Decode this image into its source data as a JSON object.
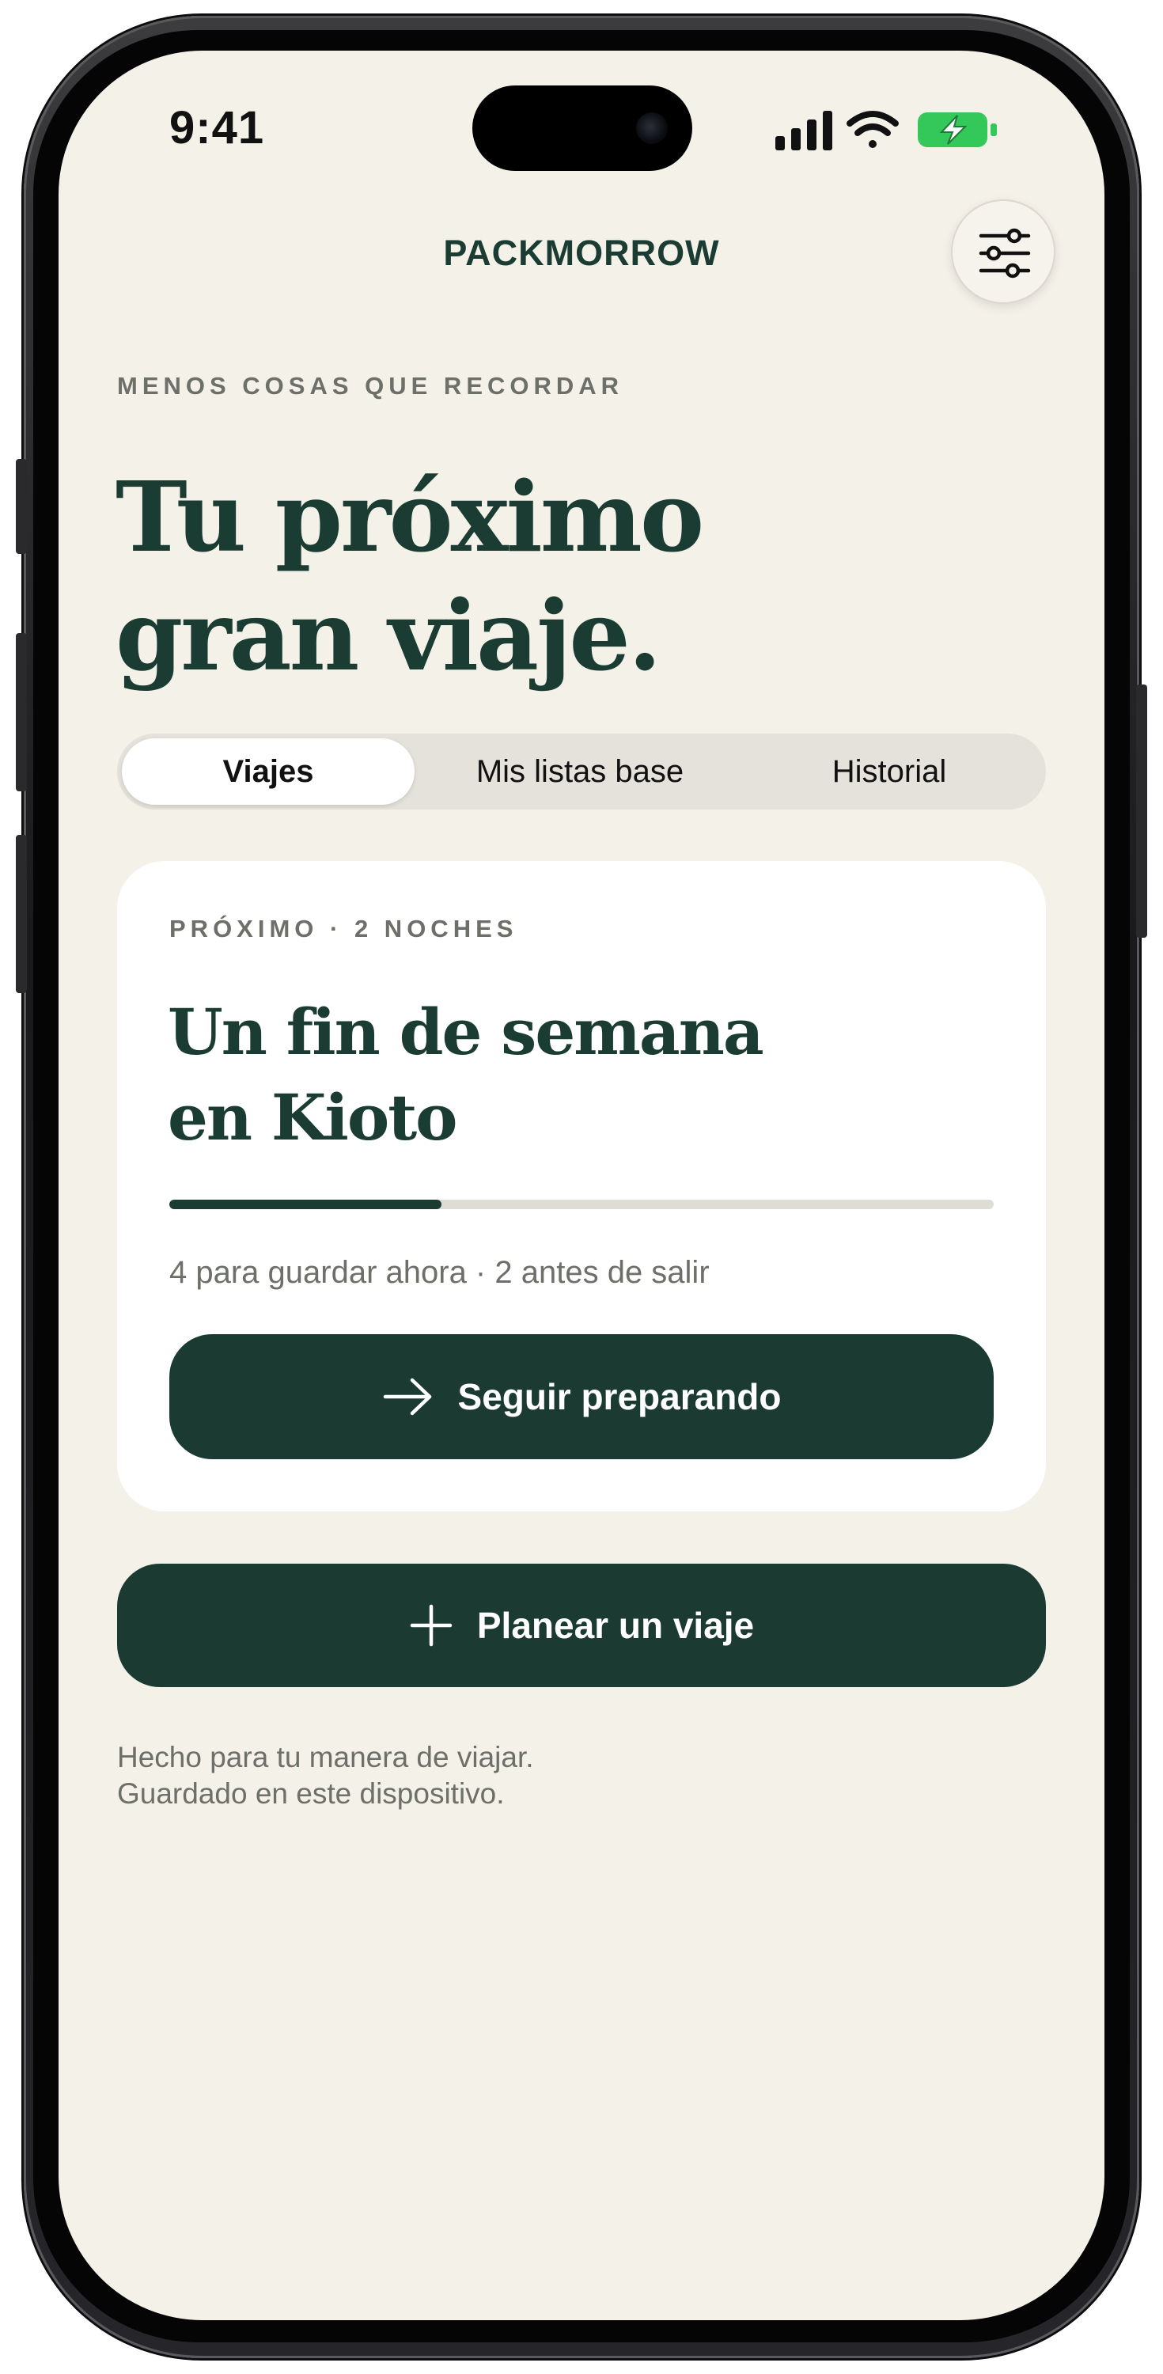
{
  "status_bar": {
    "time": "9:41",
    "battery_color": "#34c759"
  },
  "header": {
    "brand": "PACKMORROW",
    "settings_icon": "sliders-icon"
  },
  "hero": {
    "eyebrow": "MENOS COSAS QUE RECORDAR",
    "title_line1": "Tu próximo",
    "title_line2": "gran viaje."
  },
  "tabs": [
    {
      "label": "Viajes",
      "active": true
    },
    {
      "label": "Mis listas base",
      "active": false
    },
    {
      "label": "Historial",
      "active": false
    }
  ],
  "trip_card": {
    "eyebrow": "PRÓXIMO · 2 NOCHES",
    "title_line1": "Un fin de semana",
    "title_line2": "en Kioto",
    "progress_fraction": 0.33,
    "meta": "4 para guardar ahora · 2 antes de salir",
    "button_label": "Seguir preparando",
    "button_icon": "arrow-right-icon"
  },
  "plan_button": {
    "label": "Planear un viaje",
    "icon": "plus-icon"
  },
  "footer": {
    "line1": "Hecho para tu manera de viajar.",
    "line2": "Guardado en este dispositivo."
  },
  "colors": {
    "accent": "#1b3c32",
    "background": "#f4f1e9",
    "card": "#ffffff",
    "muted_text": "#6d6f69"
  }
}
